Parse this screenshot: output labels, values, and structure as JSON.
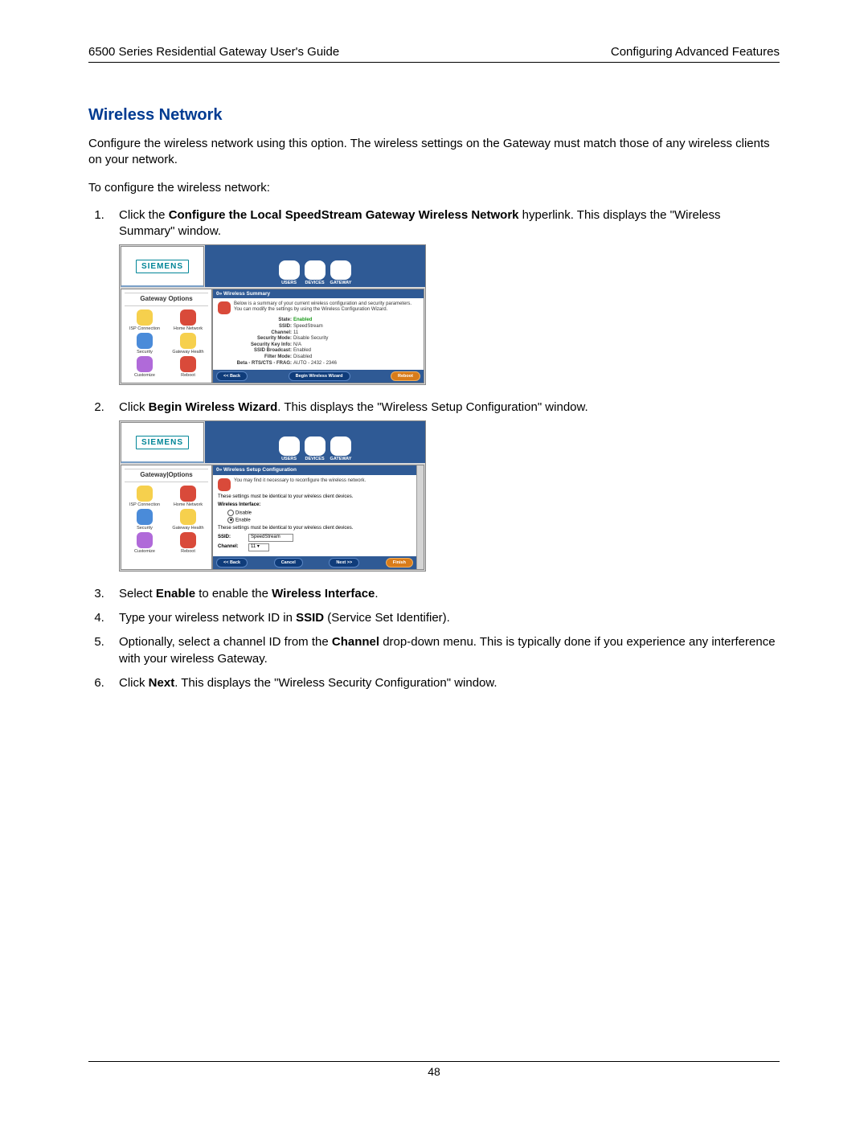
{
  "header": {
    "left": "6500 Series Residential Gateway User's Guide",
    "right": "Configuring Advanced Features"
  },
  "section_title": "Wireless Network",
  "intro1": "Configure the wireless network using this option. The wireless settings on the Gateway must match those of any wireless clients on your network.",
  "intro2": "To configure the wireless network:",
  "steps": {
    "s1a": "Click the ",
    "s1b": "Configure the Local SpeedStream Gateway Wireless Network",
    "s1c": " hyperlink. This displays the \"Wireless Summary\" window.",
    "s2a": "Click ",
    "s2b": "Begin Wireless Wizard",
    "s2c": ". This displays the \"Wireless Setup Configuration\" window.",
    "s3a": "Select ",
    "s3b": "Enable",
    "s3c": " to enable the ",
    "s3d": "Wireless Interface",
    "s3e": ".",
    "s4a": "Type your wireless network ID in ",
    "s4b": "SSID",
    "s4c": " (Service Set Identifier).",
    "s5a": "Optionally, select a channel ID from the ",
    "s5b": "Channel",
    "s5c": " drop-down menu. This is typically done if you experience any interference with your wireless Gateway.",
    "s6a": "Click ",
    "s6b": "Next",
    "s6c": ". This displays the \"Wireless Security Configuration\" window."
  },
  "shot_common": {
    "logo": "SIEMENS",
    "tabs": {
      "users": "USERS",
      "devices": "DEVICES",
      "gateway": "GATEWAY"
    },
    "side_title": "Gateway Options",
    "side_title2": "Gateway|Options",
    "side_items": {
      "isp": "ISP Connection",
      "home": "Home Network",
      "sec": "Security",
      "health": "Gateway Health",
      "cust": "Customize",
      "reboot": "Reboot"
    }
  },
  "shot1": {
    "bar": "0» Wireless Summary",
    "desc": "Below is a summary of your current wireless configuration and security parameters. You can modify the settings by using the Wireless Configuration Wizard.",
    "kv": {
      "state_k": "State:",
      "state_v": "Enabled",
      "ssid_k": "SSID:",
      "ssid_v": "SpeedStream",
      "chan_k": "Channel:",
      "chan_v": "11",
      "secm_k": "Security Mode:",
      "secm_v": "Disable Security",
      "seck_k": "Security Key Info:",
      "seck_v": "N/A",
      "bcast_k": "SSID Broadcast:",
      "bcast_v": "Enabled",
      "filt_k": "Filter Mode:",
      "filt_v": "Disabled",
      "beta_k": "Beta - RTS/CTS - FRAG:",
      "beta_v": "AUTO - 2432 - 2346"
    },
    "btn_back": "<< Back",
    "btn_begin": "Begin Wireless Wizard",
    "btn_reboot": "Reboot"
  },
  "shot2": {
    "bar": "0» Wireless Setup Configuration",
    "desc": "You may find it necessary to reconfigure the wireless network.",
    "note1": "These settings must be identical to your wireless client devices.",
    "iface_label": "Wireless Interface:",
    "opt_disable": "Disable",
    "opt_enable": "Enable",
    "note2": "These settings must be identical to your wireless client devices.",
    "ssid_label": "SSID:",
    "ssid_value": "SpeedStream",
    "chan_label": "Channel:",
    "chan_value": "11",
    "btn_back": "<< Back",
    "btn_cancel": "Cancel",
    "btn_next": "Next >>",
    "btn_finish": "Finish"
  },
  "page_number": "48"
}
